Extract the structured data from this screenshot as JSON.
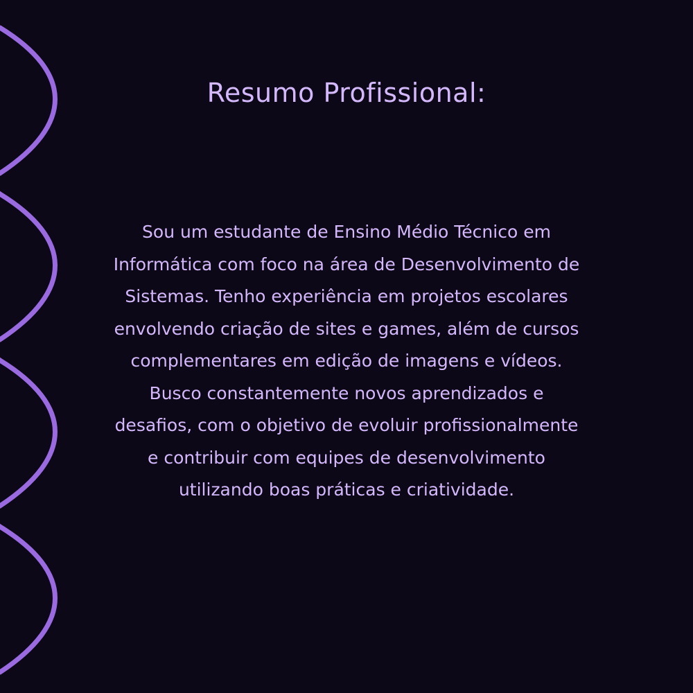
{
  "title": "Resumo Profissional:",
  "summary_lines": [
    "Sou um estudante de Ensino Médio Técnico em",
    "Informática com foco na área de Desenvolvimento de",
    "Sistemas. Tenho experiência em projetos escolares",
    "envolvendo criação de sites e games, além de cursos",
    "complementares em edição de imagens e vídeos.",
    "Busco constantemente novos aprendizados e",
    "desafios, com o objetivo de evoluir profissionalmente",
    "e contribuir com equipes de desenvolvimento",
    "utilizando boas práticas e criatividade."
  ],
  "colors": {
    "background": "#0d0818",
    "text": "#d3b8fb",
    "wave": "#9a6ae0"
  }
}
